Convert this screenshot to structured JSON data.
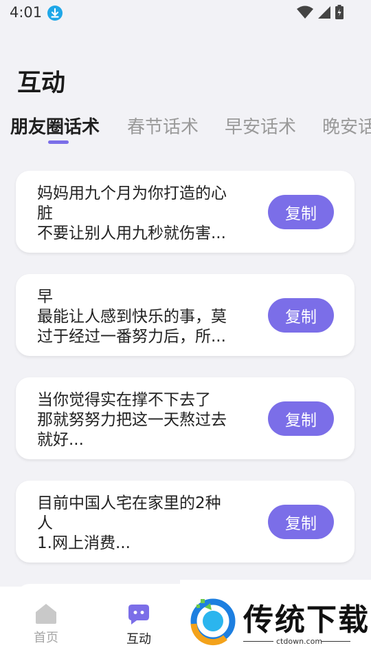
{
  "status": {
    "time": "4:01"
  },
  "page": {
    "title": "互动"
  },
  "tabs": [
    {
      "label": "朋友圈话术"
    },
    {
      "label": "春节话术"
    },
    {
      "label": "早安话术"
    },
    {
      "label": "晚安话术"
    }
  ],
  "cards": [
    {
      "lines": [
        "妈妈用九个月为你打造的心",
        "脏",
        "不要让别人用九秒就伤害..."
      ],
      "button": "复制"
    },
    {
      "lines": [
        "早",
        "最能让人感到快乐的事，莫",
        "过于经过一番努力后，所..."
      ],
      "button": "复制"
    },
    {
      "lines": [
        "当你觉得实在撑不下去了",
        "那就努努力把这一天熬过去",
        "就好..."
      ],
      "button": "复制"
    },
    {
      "lines": [
        "目前中国人宅在家里的2种",
        "人",
        "1.网上消费..."
      ],
      "button": "复制"
    }
  ],
  "nav": [
    {
      "label": "首页"
    },
    {
      "label": "互动"
    }
  ],
  "watermark": {
    "title": "传统下载",
    "site": "ctdown.com"
  },
  "colors": {
    "accent": "#7b6ee8",
    "background": "#f2f2f6",
    "card": "#ffffff"
  }
}
